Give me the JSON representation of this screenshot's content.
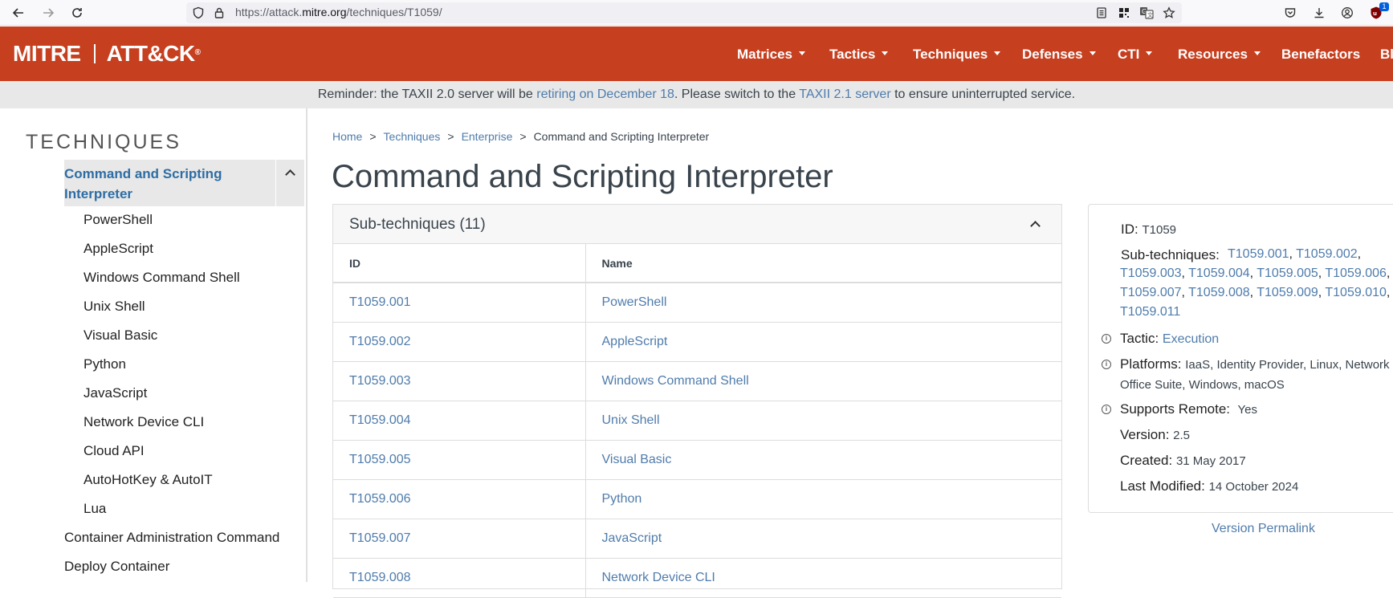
{
  "browser": {
    "url_prefix": "https://attack.",
    "url_domain": "mitre.org",
    "url_path": "/techniques/T1059/",
    "badge_count": "1"
  },
  "header": {
    "logo_left": "MITRE",
    "logo_right": "ATT&CK",
    "logo_reg": "®",
    "nav": [
      "Matrices",
      "Tactics",
      "Techniques",
      "Defenses",
      "CTI",
      "Resources",
      "Benefactors",
      "Bl"
    ]
  },
  "banner": {
    "prefix": "Reminder: the TAXII 2.0 server will be ",
    "link1": "retiring on December 18",
    "middle": ". Please switch to the ",
    "link2": "TAXII 2.1 server",
    "suffix": " to ensure uninterrupted service."
  },
  "sidebar": {
    "title": "TECHNIQUES",
    "active": "Command and Scripting Interpreter",
    "subitems": [
      "PowerShell",
      "AppleScript",
      "Windows Command Shell",
      "Unix Shell",
      "Visual Basic",
      "Python",
      "JavaScript",
      "Network Device CLI",
      "Cloud API",
      "AutoHotKey & AutoIT",
      "Lua"
    ],
    "items": [
      "Container Administration Command",
      "Deploy Container"
    ]
  },
  "breadcrumb": [
    "Home",
    "Techniques",
    "Enterprise",
    "Command and Scripting Interpreter"
  ],
  "breadcrumb_sep": ">",
  "page_title": "Command and Scripting Interpreter",
  "subtechniques": {
    "title": "Sub-techniques (11)",
    "headers": [
      "ID",
      "Name"
    ],
    "rows": [
      {
        "id": "T1059.001",
        "name": "PowerShell"
      },
      {
        "id": "T1059.002",
        "name": "AppleScript"
      },
      {
        "id": "T1059.003",
        "name": "Windows Command Shell"
      },
      {
        "id": "T1059.004",
        "name": "Unix Shell"
      },
      {
        "id": "T1059.005",
        "name": "Visual Basic"
      },
      {
        "id": "T1059.006",
        "name": "Python"
      },
      {
        "id": "T1059.007",
        "name": "JavaScript"
      },
      {
        "id": "T1059.008",
        "name": "Network Device CLI"
      }
    ]
  },
  "info": {
    "id_label": "ID:",
    "id_value": "T1059",
    "sub_label": "Sub-techniques:",
    "sub_links": [
      "T1059.001",
      "T1059.002",
      "T1059.003",
      "T1059.004",
      "T1059.005",
      "T1059.006",
      "T1059.007",
      "T1059.008",
      "T1059.009",
      "T1059.010",
      "T1059.011"
    ],
    "tactic_label": "Tactic:",
    "tactic_value": "Execution",
    "platforms_label": "Platforms:",
    "platforms_line1": "IaaS, Identity Provider, Linux, Network",
    "platforms_line2": "Office Suite, Windows, macOS",
    "remote_label": "Supports Remote:",
    "remote_value": "Yes",
    "version_label": "Version:",
    "version_value": "2.5",
    "created_label": "Created:",
    "created_value": "31 May 2017",
    "modified_label": "Last Modified:",
    "modified_value": "14 October 2024",
    "permalink": "Version Permalink"
  }
}
